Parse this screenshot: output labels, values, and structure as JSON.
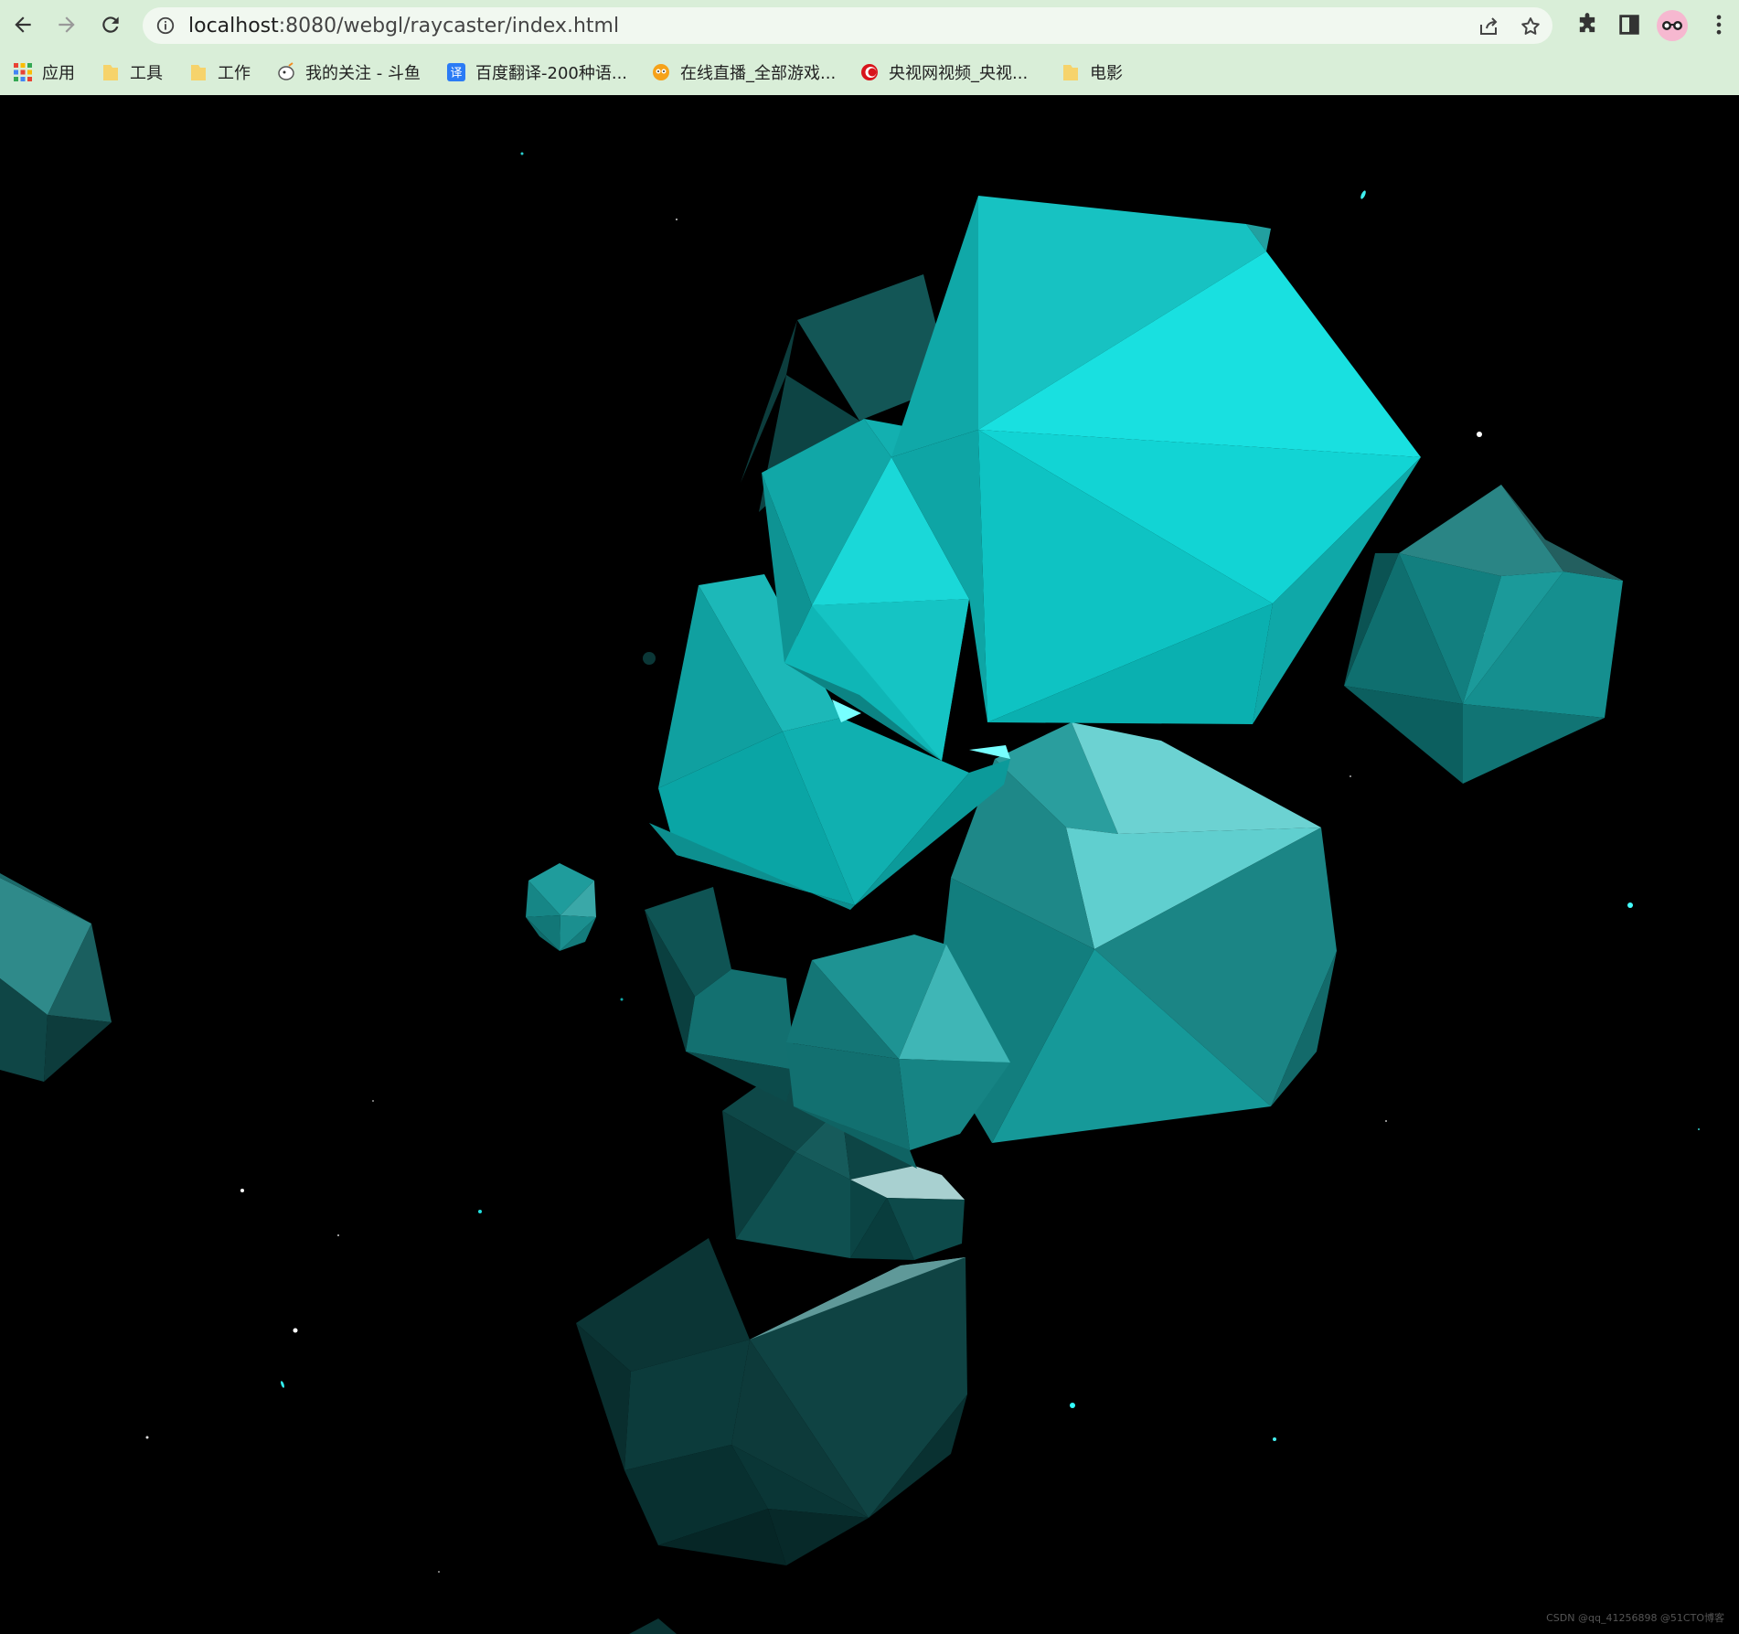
{
  "browser": {
    "url_host": "localhost",
    "url_rest": ":8080/webgl/raycaster/index.html"
  },
  "bookmarks": [
    {
      "label": "应用",
      "icon": "apps-grid-icon"
    },
    {
      "label": "工具",
      "icon": "folder-icon"
    },
    {
      "label": "工作",
      "icon": "folder-icon"
    },
    {
      "label": "我的关注 - 斗鱼",
      "icon": "douyu-icon"
    },
    {
      "label": "百度翻译-200种语...",
      "icon": "baidu-translate-icon"
    },
    {
      "label": "在线直播_全部游戏...",
      "icon": "huya-icon"
    },
    {
      "label": "央视网视频_央视...",
      "icon": "cctv-icon"
    },
    {
      "label": "电影",
      "icon": "folder-icon"
    }
  ],
  "scene": {
    "background": "#000000",
    "object_color": "#1ae2e0"
  },
  "watermark": "CSDN @qq_41256898 @51CTO博客"
}
